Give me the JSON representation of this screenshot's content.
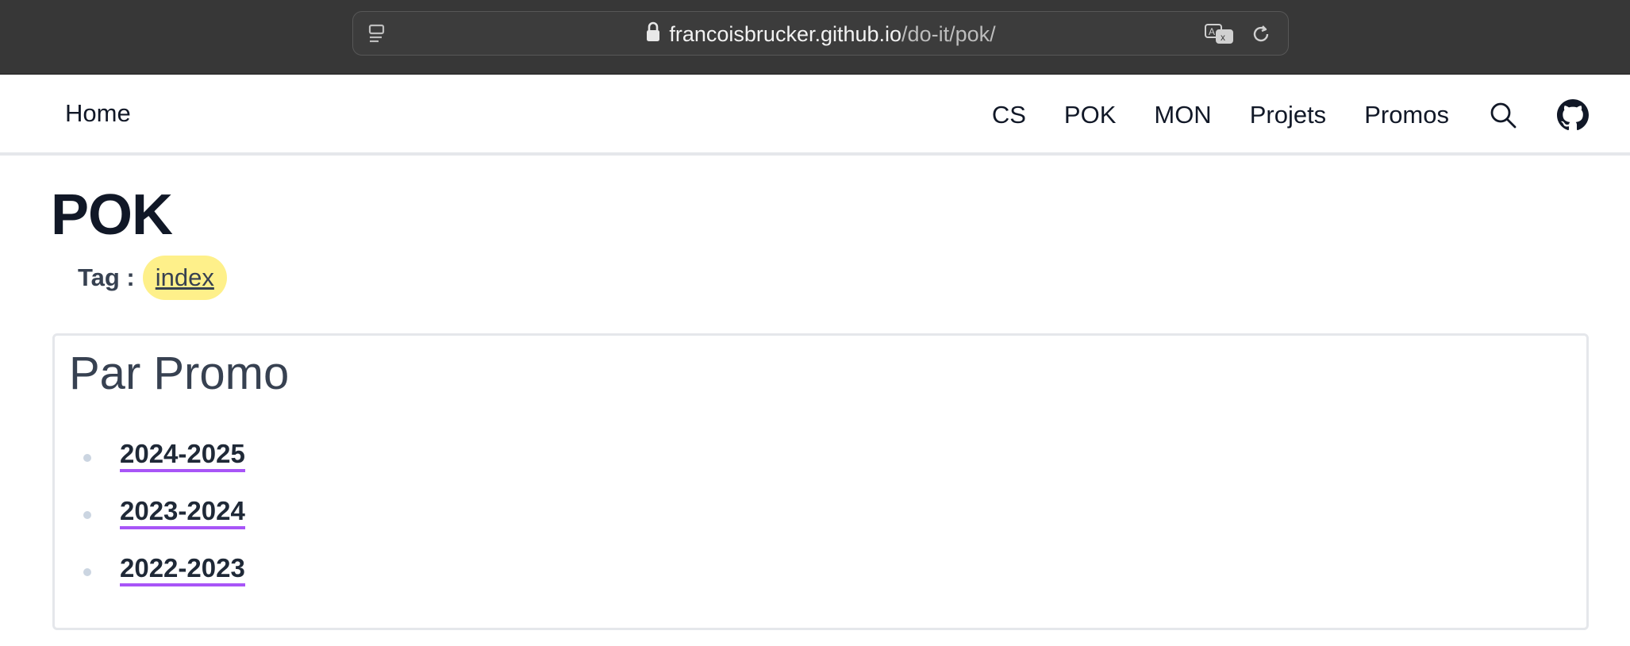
{
  "browser": {
    "url_host": "francoisbrucker.github.io",
    "url_path": "/do-it/pok/",
    "icons": [
      "sidebar-icon",
      "lock-icon",
      "translate-icon",
      "reload-icon"
    ]
  },
  "nav": {
    "home": "Home",
    "links": [
      "CS",
      "POK",
      "MON",
      "Projets",
      "Promos"
    ],
    "icons": [
      "search-icon",
      "github-icon"
    ]
  },
  "page": {
    "title": "POK",
    "tag_label": "Tag :",
    "tag": "index"
  },
  "card": {
    "title": "Par Promo",
    "items": [
      "2024-2025",
      "2023-2024",
      "2022-2023"
    ]
  },
  "colors": {
    "chrome_bg": "#373737",
    "tag_bg": "#fef08a",
    "link_underline": "#a855f7",
    "title": "#111827"
  }
}
